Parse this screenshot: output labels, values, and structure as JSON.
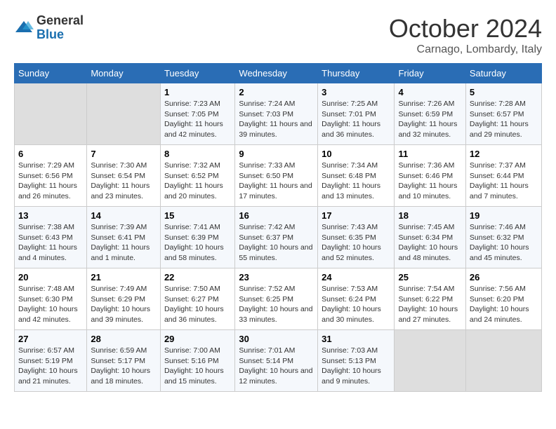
{
  "header": {
    "logo_general": "General",
    "logo_blue": "Blue",
    "month_title": "October 2024",
    "location": "Carnago, Lombardy, Italy"
  },
  "weekdays": [
    "Sunday",
    "Monday",
    "Tuesday",
    "Wednesday",
    "Thursday",
    "Friday",
    "Saturday"
  ],
  "weeks": [
    [
      {
        "day": "",
        "empty": true
      },
      {
        "day": "",
        "empty": true
      },
      {
        "day": "1",
        "sunrise": "Sunrise: 7:23 AM",
        "sunset": "Sunset: 7:05 PM",
        "daylight": "Daylight: 11 hours and 42 minutes."
      },
      {
        "day": "2",
        "sunrise": "Sunrise: 7:24 AM",
        "sunset": "Sunset: 7:03 PM",
        "daylight": "Daylight: 11 hours and 39 minutes."
      },
      {
        "day": "3",
        "sunrise": "Sunrise: 7:25 AM",
        "sunset": "Sunset: 7:01 PM",
        "daylight": "Daylight: 11 hours and 36 minutes."
      },
      {
        "day": "4",
        "sunrise": "Sunrise: 7:26 AM",
        "sunset": "Sunset: 6:59 PM",
        "daylight": "Daylight: 11 hours and 32 minutes."
      },
      {
        "day": "5",
        "sunrise": "Sunrise: 7:28 AM",
        "sunset": "Sunset: 6:57 PM",
        "daylight": "Daylight: 11 hours and 29 minutes."
      }
    ],
    [
      {
        "day": "6",
        "sunrise": "Sunrise: 7:29 AM",
        "sunset": "Sunset: 6:56 PM",
        "daylight": "Daylight: 11 hours and 26 minutes."
      },
      {
        "day": "7",
        "sunrise": "Sunrise: 7:30 AM",
        "sunset": "Sunset: 6:54 PM",
        "daylight": "Daylight: 11 hours and 23 minutes."
      },
      {
        "day": "8",
        "sunrise": "Sunrise: 7:32 AM",
        "sunset": "Sunset: 6:52 PM",
        "daylight": "Daylight: 11 hours and 20 minutes."
      },
      {
        "day": "9",
        "sunrise": "Sunrise: 7:33 AM",
        "sunset": "Sunset: 6:50 PM",
        "daylight": "Daylight: 11 hours and 17 minutes."
      },
      {
        "day": "10",
        "sunrise": "Sunrise: 7:34 AM",
        "sunset": "Sunset: 6:48 PM",
        "daylight": "Daylight: 11 hours and 13 minutes."
      },
      {
        "day": "11",
        "sunrise": "Sunrise: 7:36 AM",
        "sunset": "Sunset: 6:46 PM",
        "daylight": "Daylight: 11 hours and 10 minutes."
      },
      {
        "day": "12",
        "sunrise": "Sunrise: 7:37 AM",
        "sunset": "Sunset: 6:44 PM",
        "daylight": "Daylight: 11 hours and 7 minutes."
      }
    ],
    [
      {
        "day": "13",
        "sunrise": "Sunrise: 7:38 AM",
        "sunset": "Sunset: 6:43 PM",
        "daylight": "Daylight: 11 hours and 4 minutes."
      },
      {
        "day": "14",
        "sunrise": "Sunrise: 7:39 AM",
        "sunset": "Sunset: 6:41 PM",
        "daylight": "Daylight: 11 hours and 1 minute."
      },
      {
        "day": "15",
        "sunrise": "Sunrise: 7:41 AM",
        "sunset": "Sunset: 6:39 PM",
        "daylight": "Daylight: 10 hours and 58 minutes."
      },
      {
        "day": "16",
        "sunrise": "Sunrise: 7:42 AM",
        "sunset": "Sunset: 6:37 PM",
        "daylight": "Daylight: 10 hours and 55 minutes."
      },
      {
        "day": "17",
        "sunrise": "Sunrise: 7:43 AM",
        "sunset": "Sunset: 6:35 PM",
        "daylight": "Daylight: 10 hours and 52 minutes."
      },
      {
        "day": "18",
        "sunrise": "Sunrise: 7:45 AM",
        "sunset": "Sunset: 6:34 PM",
        "daylight": "Daylight: 10 hours and 48 minutes."
      },
      {
        "day": "19",
        "sunrise": "Sunrise: 7:46 AM",
        "sunset": "Sunset: 6:32 PM",
        "daylight": "Daylight: 10 hours and 45 minutes."
      }
    ],
    [
      {
        "day": "20",
        "sunrise": "Sunrise: 7:48 AM",
        "sunset": "Sunset: 6:30 PM",
        "daylight": "Daylight: 10 hours and 42 minutes."
      },
      {
        "day": "21",
        "sunrise": "Sunrise: 7:49 AM",
        "sunset": "Sunset: 6:29 PM",
        "daylight": "Daylight: 10 hours and 39 minutes."
      },
      {
        "day": "22",
        "sunrise": "Sunrise: 7:50 AM",
        "sunset": "Sunset: 6:27 PM",
        "daylight": "Daylight: 10 hours and 36 minutes."
      },
      {
        "day": "23",
        "sunrise": "Sunrise: 7:52 AM",
        "sunset": "Sunset: 6:25 PM",
        "daylight": "Daylight: 10 hours and 33 minutes."
      },
      {
        "day": "24",
        "sunrise": "Sunrise: 7:53 AM",
        "sunset": "Sunset: 6:24 PM",
        "daylight": "Daylight: 10 hours and 30 minutes."
      },
      {
        "day": "25",
        "sunrise": "Sunrise: 7:54 AM",
        "sunset": "Sunset: 6:22 PM",
        "daylight": "Daylight: 10 hours and 27 minutes."
      },
      {
        "day": "26",
        "sunrise": "Sunrise: 7:56 AM",
        "sunset": "Sunset: 6:20 PM",
        "daylight": "Daylight: 10 hours and 24 minutes."
      }
    ],
    [
      {
        "day": "27",
        "sunrise": "Sunrise: 6:57 AM",
        "sunset": "Sunset: 5:19 PM",
        "daylight": "Daylight: 10 hours and 21 minutes."
      },
      {
        "day": "28",
        "sunrise": "Sunrise: 6:59 AM",
        "sunset": "Sunset: 5:17 PM",
        "daylight": "Daylight: 10 hours and 18 minutes."
      },
      {
        "day": "29",
        "sunrise": "Sunrise: 7:00 AM",
        "sunset": "Sunset: 5:16 PM",
        "daylight": "Daylight: 10 hours and 15 minutes."
      },
      {
        "day": "30",
        "sunrise": "Sunrise: 7:01 AM",
        "sunset": "Sunset: 5:14 PM",
        "daylight": "Daylight: 10 hours and 12 minutes."
      },
      {
        "day": "31",
        "sunrise": "Sunrise: 7:03 AM",
        "sunset": "Sunset: 5:13 PM",
        "daylight": "Daylight: 10 hours and 9 minutes."
      },
      {
        "day": "",
        "empty": true
      },
      {
        "day": "",
        "empty": true
      }
    ]
  ]
}
